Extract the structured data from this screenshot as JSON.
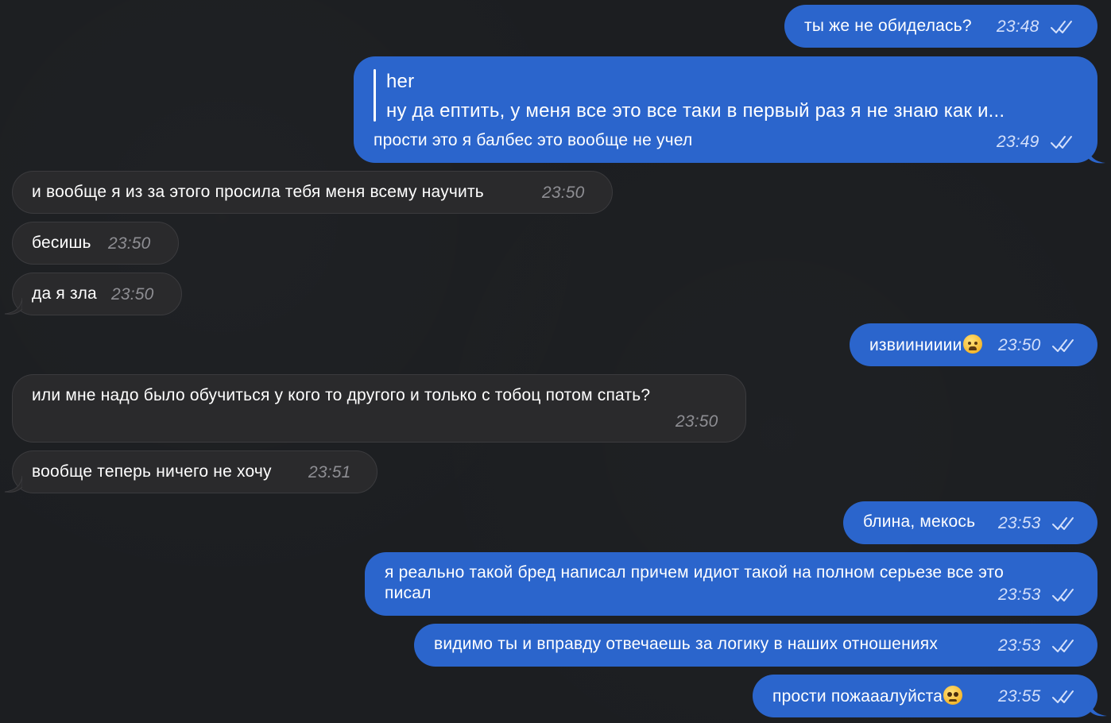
{
  "messages": [
    {
      "text": "ты же не обиделась?",
      "time": "23:48"
    },
    {
      "reply_name": "her",
      "reply_text": "ну да ептить, у меня все это все таки в первый раз я не знаю как и...",
      "text": "прости это я балбес это вообще не учел",
      "time": "23:49"
    },
    {
      "text": "и вообще я из за этого просила тебя меня всему научить",
      "time": "23:50"
    },
    {
      "text": "бесишь",
      "time": "23:50"
    },
    {
      "text": "да я зла",
      "time": "23:50"
    },
    {
      "text": "извиинииии",
      "emoji": "weary-face-emoji",
      "time": "23:50"
    },
    {
      "text": "или мне надо было обучиться у кого то другого и только с тобоц потом спать?",
      "time": "23:50"
    },
    {
      "text": "вообще теперь ничего не хочу",
      "time": "23:51"
    },
    {
      "text": "блина, мекось",
      "time": "23:53"
    },
    {
      "text_line1": "я реально такой бред написал причем идиот такой на полном серьезе все это",
      "text_line2": "писал",
      "time": "23:53"
    },
    {
      "text": "видимо ты и вправду отвечаешь за логику в наших отношениях",
      "time": "23:53"
    },
    {
      "text": "прости пожааалуйста",
      "emoji": "pleading-face-emoji",
      "time": "23:55"
    }
  ],
  "colors": {
    "background": "#1c1e21",
    "outgoing_bubble": "#2b65cc",
    "incoming_bubble": "#2a2a2c",
    "incoming_time": "#8e8e93",
    "outgoing_time": "#d4e0fb"
  },
  "icons": {
    "read_receipt": "double-check-icon"
  }
}
